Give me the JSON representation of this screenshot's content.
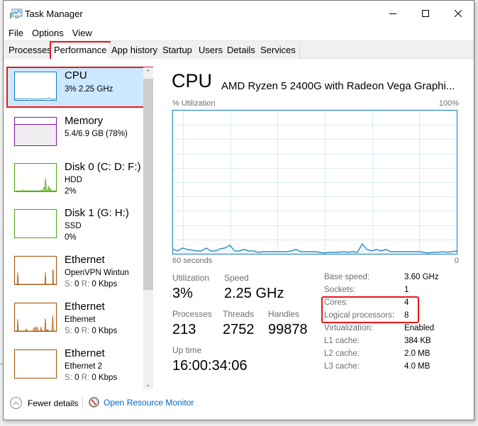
{
  "window": {
    "title": "Task Manager",
    "controls": {
      "minimize": "minimize",
      "maximize": "maximize",
      "close": "close"
    }
  },
  "menu": [
    "File",
    "Options",
    "View"
  ],
  "tabs": [
    {
      "label": "Processes",
      "active": false
    },
    {
      "label": "Performance",
      "active": true
    },
    {
      "label": "App history",
      "active": false
    },
    {
      "label": "Startup",
      "active": false
    },
    {
      "label": "Users",
      "active": false
    },
    {
      "label": "Details",
      "active": false
    },
    {
      "label": "Services",
      "active": false
    }
  ],
  "sidebar": {
    "items": [
      {
        "name": "CPU",
        "lines": [
          "3% 2.25 GHz"
        ],
        "color": "#117dbb",
        "selected": true
      },
      {
        "name": "Memory",
        "lines": [
          "5.4/6.9 GB (78%)"
        ],
        "color": "#8b12ae",
        "usage_percent": 78
      },
      {
        "name": "Disk 0 (C: D: F:)",
        "lines": [
          "HDD",
          "2%"
        ],
        "color": "#4da60c"
      },
      {
        "name": "Disk 1 (G: H:)",
        "lines": [
          "SSD",
          "0%"
        ],
        "color": "#4da60c"
      },
      {
        "name": "Ethernet",
        "lines": [
          "OpenVPN Wintun"
        ],
        "sr_label_s": "S:",
        "sr_value_s": "0",
        "sr_label_r": "R:",
        "sr_value_r": "0 Kbps",
        "color": "#a74f01"
      },
      {
        "name": "Ethernet",
        "lines": [
          "Ethernet"
        ],
        "sr_label_s": "S:",
        "sr_value_s": "0",
        "sr_label_r": "R:",
        "sr_value_r": "0 Kbps",
        "color": "#a74f01"
      },
      {
        "name": "Ethernet",
        "lines": [
          "Ethernet 2"
        ],
        "sr_label_s": "S:",
        "sr_value_s": "0",
        "sr_label_r": "R:",
        "sr_value_r": "0 Kbps",
        "color": "#a74f01"
      }
    ]
  },
  "main": {
    "title": "CPU",
    "model": "AMD Ryzen 5 2400G with Radeon Vega Graphi...",
    "graph": {
      "y_label": "% Utilization",
      "y_max_label": "100%",
      "x_left_label": "60 seconds",
      "x_right_label": "0",
      "color": "#117dbb",
      "grid_color": "#d9eaf4"
    },
    "stats": {
      "utilization_label": "Utilization",
      "utilization_value": "3%",
      "speed_label": "Speed",
      "speed_value": "2.25 GHz",
      "processes_label": "Processes",
      "processes_value": "213",
      "threads_label": "Threads",
      "threads_value": "2752",
      "handles_label": "Handles",
      "handles_value": "99878",
      "uptime_label": "Up time",
      "uptime_value": "16:00:34:06"
    },
    "specs": [
      {
        "label": "Base speed:",
        "value": "3.60 GHz"
      },
      {
        "label": "Sockets:",
        "value": "1"
      },
      {
        "label": "Cores:",
        "value": "4"
      },
      {
        "label": "Logical processors:",
        "value": "8"
      },
      {
        "label": "Virtualization:",
        "value": "Enabled"
      },
      {
        "label": "L1 cache:",
        "value": "384 KB"
      },
      {
        "label": "L2 cache:",
        "value": "2.0 MB"
      },
      {
        "label": "L3 cache:",
        "value": "4.0 MB"
      }
    ]
  },
  "footer": {
    "fewer_details": "Fewer details",
    "open_resource_monitor": "Open Resource Monitor"
  },
  "chart_data": {
    "type": "area",
    "title": "CPU % Utilization",
    "xlabel": "60 seconds",
    "ylabel": "% Utilization",
    "xlim": [
      60,
      0
    ],
    "ylim": [
      0,
      100
    ],
    "grid": true,
    "x": [
      60,
      59,
      58,
      57,
      56,
      55,
      54,
      53,
      52,
      51,
      50,
      49,
      48,
      47,
      46,
      45,
      44,
      43,
      42,
      41,
      40,
      39,
      38,
      37,
      36,
      35,
      34,
      33,
      32,
      31,
      30,
      29,
      28,
      27,
      26,
      25,
      24,
      23,
      22,
      21,
      20,
      19,
      18,
      17,
      16,
      15,
      14,
      13,
      12,
      11,
      10,
      9,
      8,
      7,
      6,
      5,
      4,
      3,
      2,
      1,
      0
    ],
    "series": [
      {
        "name": "CPU",
        "values": [
          3,
          2,
          4,
          3,
          2.5,
          2,
          2,
          4,
          2,
          2,
          3.5,
          4,
          6,
          2,
          2,
          3,
          2,
          2,
          1,
          1.5,
          1.5,
          1.5,
          1.5,
          1.5,
          1.5,
          2,
          3,
          1.5,
          1.5,
          1.5,
          1.5,
          1,
          0.5,
          1,
          1,
          1,
          1.5,
          1,
          1.5,
          1,
          7,
          3,
          2,
          3,
          2,
          3,
          1.5,
          1.5,
          1.5,
          1.5,
          1.5,
          1.5,
          1.5,
          1,
          0.5,
          1,
          1,
          1.5,
          1,
          1.5,
          2
        ]
      }
    ]
  }
}
